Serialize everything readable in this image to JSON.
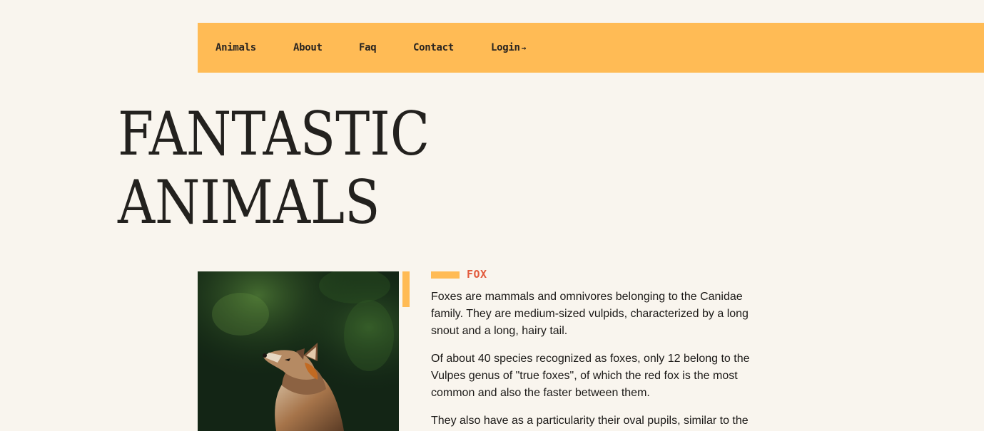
{
  "nav": {
    "items": [
      {
        "label": "Animals"
      },
      {
        "label": "About"
      },
      {
        "label": "Faq"
      },
      {
        "label": "Contact"
      },
      {
        "label": "Login"
      }
    ],
    "login_arrow": "→"
  },
  "hero": {
    "title_line1": "FANTASTIC",
    "title_line2": "ANIMALS"
  },
  "article": {
    "tag": "FOX",
    "paragraphs": [
      "Foxes are mammals and omnivores belonging to the Canidae family. They are medium-sized vulpids, characterized by a long snout and a long, hairy tail.",
      "Of about 40 species recognized as foxes, only 12 belong to the Vulpes genus of \"true foxes\", of which the red fox is the most common and also the faster between them.",
      "They also have as a particularity their oval pupils, similar to the"
    ]
  },
  "colors": {
    "background": "#f9f5ee",
    "accent": "#ffbb55",
    "tag": "#e25a3c",
    "text": "#1c1a18"
  }
}
